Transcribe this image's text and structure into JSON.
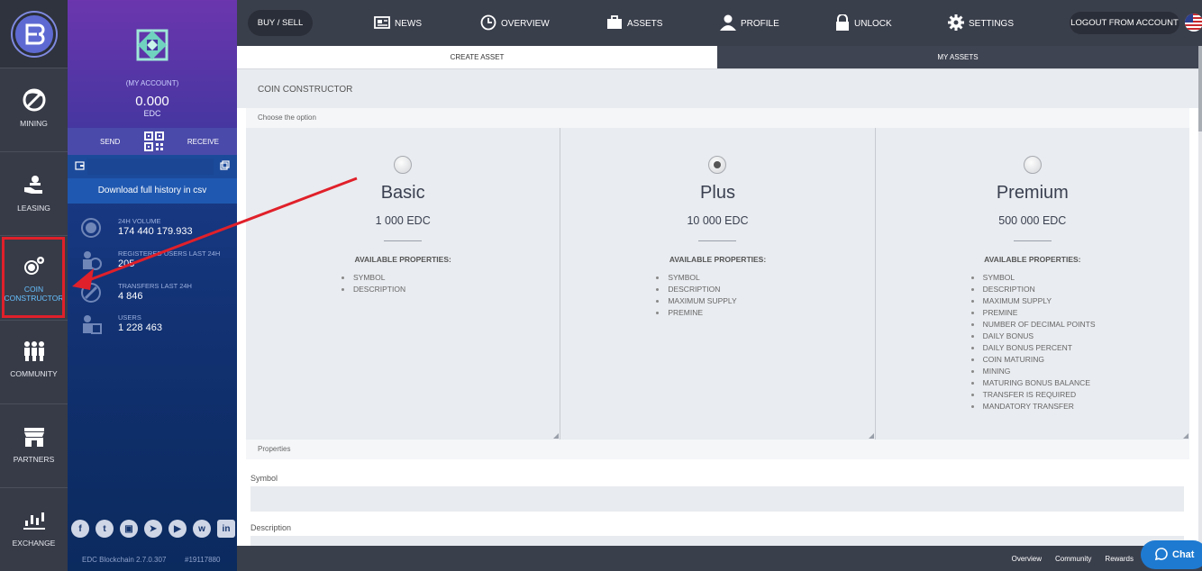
{
  "rail": {
    "items": [
      {
        "label": "MINING",
        "icon": "pickaxe-icon"
      },
      {
        "label": "LEASING",
        "icon": "hand-coins-icon"
      },
      {
        "label": "COIN\nCONSTRUCTOR",
        "label_line1": "COIN",
        "label_line2": "CONSTRUCTOR",
        "icon": "gear-coin-icon"
      },
      {
        "label": "COMMUNITY",
        "icon": "people-icon"
      },
      {
        "label": "PARTNERS",
        "icon": "store-icon"
      },
      {
        "label": "EXCHANGE",
        "icon": "candlestick-icon"
      }
    ]
  },
  "account": {
    "label": "(MY ACCOUNT)",
    "balance": "0.000",
    "unit": "EDC",
    "send": "SEND",
    "receive": "RECEIVE",
    "download": "Download full history in csv",
    "stats": [
      {
        "label": "24H VOLUME",
        "value": "174 440 179.933"
      },
      {
        "label": "REGISTERED USERS LAST 24H",
        "value": "205"
      },
      {
        "label": "TRANSFERS LAST 24H",
        "value": "4 846"
      },
      {
        "label": "USERS",
        "value": "1 228 463"
      }
    ],
    "version": "EDC Blockchain 2.7.0.307",
    "block": "#19117880"
  },
  "topnav": {
    "buysell": "BUY / SELL",
    "news": "NEWS",
    "overview": "OVERVIEW",
    "assets": "ASSETS",
    "profile": "PROFILE",
    "unlock": "UNLOCK",
    "settings": "SETTINGS",
    "logout": "LOGOUT FROM ACCOUNT"
  },
  "tabs": {
    "create": "CREATE ASSET",
    "my": "MY ASSETS"
  },
  "constructor": {
    "title": "COIN CONSTRUCTOR",
    "choose": "Choose the option",
    "props_header": "AVAILABLE PROPERTIES:",
    "plans": [
      {
        "name": "Basic",
        "price": "1 000 EDC",
        "selected": false,
        "props": [
          "SYMBOL",
          "DESCRIPTION"
        ]
      },
      {
        "name": "Plus",
        "price": "10 000 EDC",
        "selected": true,
        "props": [
          "SYMBOL",
          "DESCRIPTION",
          "MAXIMUM SUPPLY",
          "PREMINE"
        ]
      },
      {
        "name": "Premium",
        "price": "500 000 EDC",
        "selected": false,
        "props": [
          "SYMBOL",
          "DESCRIPTION",
          "MAXIMUM SUPPLY",
          "PREMINE",
          "NUMBER OF DECIMAL POINTS",
          "DAILY BONUS",
          "DAILY BONUS PERCENT",
          "COIN MATURING",
          "MINING",
          "MATURING BONUS BALANCE",
          "TRANSFER IS REQUIRED",
          "MANDATORY TRANSFER"
        ]
      }
    ],
    "properties": "Properties",
    "symbol_label": "Symbol",
    "description_label": "Description"
  },
  "footer": {
    "overview": "Overview",
    "community": "Community",
    "rewards": "Rewards",
    "chat": "Chat"
  },
  "colors": {
    "highlight": "#e0202a",
    "accent": "#1e7ad1"
  }
}
